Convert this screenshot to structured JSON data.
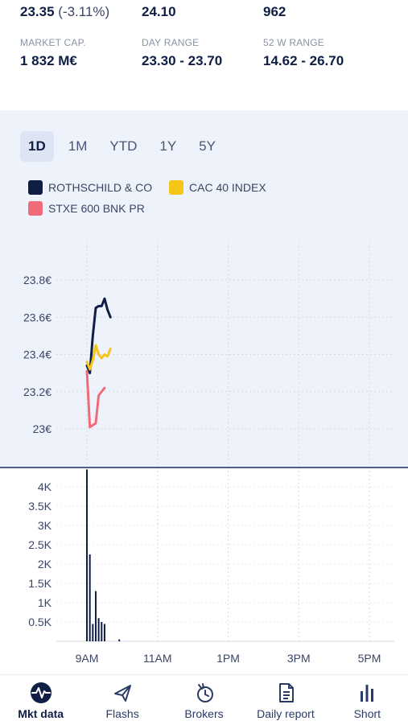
{
  "stats_row1": [
    {
      "value": "23.35",
      "change": "(-3.11%)"
    },
    {
      "value": "24.10"
    },
    {
      "value": "962"
    }
  ],
  "stats_row2": [
    {
      "label": "MARKET CAP.",
      "value": "1 832 M€"
    },
    {
      "label": "DAY RANGE",
      "value": "23.30 - 23.70"
    },
    {
      "label": "52 W RANGE",
      "value": "14.62 - 26.70"
    }
  ],
  "tabs": [
    {
      "label": "1D",
      "active": true
    },
    {
      "label": "1M"
    },
    {
      "label": "YTD"
    },
    {
      "label": "1Y"
    },
    {
      "label": "5Y"
    }
  ],
  "legend": [
    {
      "label": "ROTHSCHILD & CO",
      "color": "#0f1e45"
    },
    {
      "label": "CAC 40 INDEX",
      "color": "#f5c518"
    },
    {
      "label": "STXE 600 BNK PR",
      "color": "#f06b7a"
    }
  ],
  "nav": [
    {
      "label": "Mkt data",
      "icon": "pulse-icon",
      "active": true
    },
    {
      "label": "Flashs",
      "icon": "send-icon"
    },
    {
      "label": "Brokers",
      "icon": "broker-icon"
    },
    {
      "label": "Daily report",
      "icon": "document-icon"
    },
    {
      "label": "Short",
      "icon": "bar-chart-icon"
    }
  ],
  "chart_data": [
    {
      "type": "line",
      "ylim": [
        22.9,
        24.0
      ],
      "y_ticks": [
        "23.8€",
        "23.6€",
        "23.4€",
        "23.2€",
        "23€"
      ],
      "y_tick_values": [
        23.8,
        23.6,
        23.4,
        23.2,
        23.0
      ],
      "series": [
        {
          "name": "ROTHSCHILD & CO",
          "color": "#0f1e45",
          "x": [
            "09:00",
            "09:05",
            "09:10",
            "09:15",
            "09:20",
            "09:25",
            "09:30",
            "09:35",
            "09:40"
          ],
          "values": [
            23.34,
            23.3,
            23.5,
            23.65,
            23.66,
            23.66,
            23.7,
            23.64,
            23.6
          ]
        },
        {
          "name": "CAC 40 INDEX",
          "color": "#f5c518",
          "x": [
            "09:00",
            "09:05",
            "09:10",
            "09:15",
            "09:20",
            "09:25",
            "09:30",
            "09:35",
            "09:40"
          ],
          "values": [
            23.36,
            23.32,
            23.37,
            23.45,
            23.4,
            23.38,
            23.4,
            23.39,
            23.43
          ]
        },
        {
          "name": "STXE 600 BNK PR",
          "color": "#f06b7a",
          "x": [
            "09:00",
            "09:05",
            "09:10",
            "09:15",
            "09:20",
            "09:25",
            "09:30"
          ],
          "values": [
            23.31,
            23.01,
            23.02,
            23.03,
            23.18,
            23.2,
            23.22
          ]
        }
      ]
    },
    {
      "type": "bar",
      "ylim": [
        0,
        4500
      ],
      "y_ticks": [
        "4K",
        "3.5K",
        "3K",
        "2.5K",
        "2K",
        "1.5K",
        "1K",
        "0.5K"
      ],
      "y_tick_values": [
        4000,
        3500,
        3000,
        2500,
        2000,
        1500,
        1000,
        500
      ],
      "x_ticks": [
        "9AM",
        "11AM",
        "1PM",
        "3PM",
        "5PM"
      ],
      "x_tick_values": [
        "09:00",
        "11:00",
        "13:00",
        "15:00",
        "17:00"
      ],
      "x": [
        "09:00",
        "09:05",
        "09:10",
        "09:15",
        "09:20",
        "09:25",
        "09:30",
        "09:35",
        "09:40",
        "09:55"
      ],
      "values": [
        4450,
        2250,
        450,
        1300,
        600,
        500,
        450,
        0,
        0,
        50
      ]
    }
  ]
}
